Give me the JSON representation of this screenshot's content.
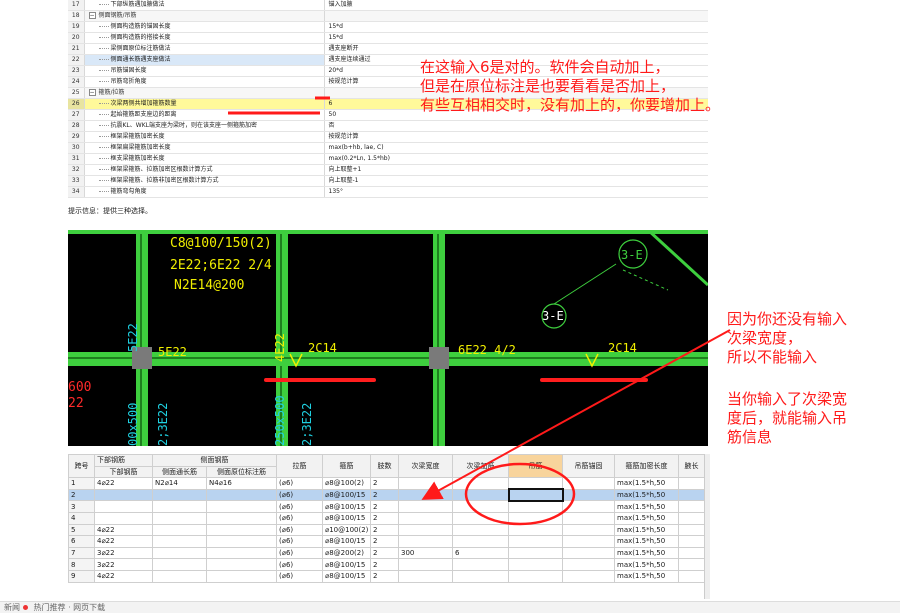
{
  "properties": {
    "rows": [
      {
        "num": "17",
        "name": "下部纵筋遇加腋做法",
        "value": "锚入加腋",
        "type": "item"
      },
      {
        "num": "18",
        "name": "侧面钢筋/吊筋",
        "value": "",
        "type": "group"
      },
      {
        "num": "19",
        "name": "侧面构造筋的锚固长度",
        "value": "15*d",
        "type": "item"
      },
      {
        "num": "20",
        "name": "侧面构造筋的搭接长度",
        "value": "15*d",
        "type": "item"
      },
      {
        "num": "21",
        "name": "梁侧面原位标注筋做法",
        "value": "遇支座断开",
        "type": "item"
      },
      {
        "num": "22",
        "name": "侧面通长筋遇支座做法",
        "value": "遇支座连续通过",
        "type": "item-hlname"
      },
      {
        "num": "23",
        "name": "吊筋锚固长度",
        "value": "20*d",
        "type": "item"
      },
      {
        "num": "24",
        "name": "吊筋弯折角度",
        "value": "按规范计算",
        "type": "item"
      },
      {
        "num": "25",
        "name": "箍筋/拉筋",
        "value": "",
        "type": "group"
      },
      {
        "num": "26",
        "name": "次梁两侧共增加箍筋数量",
        "value": "6",
        "type": "item-hl"
      },
      {
        "num": "27",
        "name": "起始箍筋距支座边的距离",
        "value": "50",
        "type": "item"
      },
      {
        "num": "28",
        "name": "抗震KL、WKL端支座为梁时，则在该支座一侧箍筋加密",
        "value": "否",
        "type": "item"
      },
      {
        "num": "29",
        "name": "框架梁箍筋加密长度",
        "value": "按规范计算",
        "type": "item"
      },
      {
        "num": "30",
        "name": "框架扁梁箍筋加密长度",
        "value": "max(b+hb, lae, C)",
        "type": "item"
      },
      {
        "num": "31",
        "name": "框支梁箍筋加密长度",
        "value": "max(0.2*Ln, 1.5*hb)",
        "type": "item"
      },
      {
        "num": "32",
        "name": "框架梁箍筋、拉筋加密区根数计算方式",
        "value": "向上取整+1",
        "type": "item"
      },
      {
        "num": "33",
        "name": "框架梁箍筋、拉筋非加密区根数计算方式",
        "value": "向上取整-1",
        "type": "item"
      },
      {
        "num": "34",
        "name": "箍筋弯勾角度",
        "value": "135°",
        "type": "item"
      }
    ],
    "hint": "提示信息：提供三种选择。"
  },
  "annotations": {
    "top": [
      "在这输入6是对的。软件会自动加上，",
      "但是在原位标注是也要看看是否加上，",
      "有些互相相交时，没有加上的，你要增加上。"
    ],
    "right1": [
      "因为你还没有输入",
      "次梁宽度，",
      "所以不能输入"
    ],
    "right2": [
      "当你输入了次梁宽",
      "度后，就能输入吊",
      "筋信息"
    ]
  },
  "cad": {
    "labels": {
      "stirrup": "C8@100/150(2)",
      "top_bars": "2E22;6E22 2/4",
      "side_bars": "N2E14@200",
      "left_5e22": "5E22",
      "bottom_5e22": "5E22",
      "v_4e22": "4E22",
      "c14_a": "2C14",
      "e22_42": "6E22 4/2",
      "c14_b": "2C14",
      "axis_3e_a": "3-E",
      "axis_3e_b": "3-E",
      "v_left": "5E22",
      "v_bot_left": "00x500",
      "v_bot_left2": "2;3E22",
      "v_bot_mid": "250x500",
      "v_bot_mid2": "2;3E22",
      "red_600": "600",
      "red_22": "22"
    }
  },
  "beam_table": {
    "group_headers": {
      "bottom": "下部钢筋",
      "side": "侧面钢筋"
    },
    "headers": [
      "跨号",
      "下部钢筋",
      "侧面通长筋",
      "侧面原位标注筋",
      "拉筋",
      "箍筋",
      "肢数",
      "次梁宽度",
      "次梁加筋",
      "吊筋",
      "吊筋锚固",
      "箍筋加密长度",
      "腋长"
    ],
    "rows": [
      [
        "1",
        "4⌀22",
        "N2⌀14",
        "N4⌀16",
        "(⌀6)",
        "⌀8@100(2)",
        "2",
        "",
        "",
        "",
        "",
        "max(1.5*h,50",
        ""
      ],
      [
        "2",
        "",
        "",
        "",
        "(⌀6)",
        "⌀8@100/15",
        "2",
        "",
        "",
        "",
        "",
        "max(1.5*h,50",
        ""
      ],
      [
        "3",
        "",
        "",
        "",
        "(⌀6)",
        "⌀8@100/15",
        "2",
        "",
        "",
        "",
        "",
        "max(1.5*h,50",
        ""
      ],
      [
        "4",
        "",
        "",
        "",
        "(⌀6)",
        "⌀8@100/15",
        "2",
        "",
        "",
        "",
        "",
        "max(1.5*h,50",
        ""
      ],
      [
        "5",
        "4⌀22",
        "",
        "",
        "(⌀6)",
        "⌀10@100(2)",
        "2",
        "",
        "",
        "",
        "",
        "max(1.5*h,50",
        ""
      ],
      [
        "6",
        "4⌀22",
        "",
        "",
        "(⌀6)",
        "⌀8@100/15",
        "2",
        "",
        "",
        "",
        "",
        "max(1.5*h,50",
        ""
      ],
      [
        "7",
        "3⌀22",
        "",
        "",
        "(⌀6)",
        "⌀8@200(2)",
        "2",
        "300",
        "6",
        "",
        "",
        "max(1.5*h,50",
        ""
      ],
      [
        "8",
        "3⌀22",
        "",
        "",
        "(⌀6)",
        "⌀8@100/15",
        "2",
        "",
        "",
        "",
        "",
        "max(1.5*h,50",
        ""
      ],
      [
        "9",
        "4⌀22",
        "",
        "",
        "(⌀6)",
        "⌀8@100/15",
        "2",
        "",
        "",
        "",
        "",
        "max(1.5*h,50",
        ""
      ]
    ]
  },
  "status": {
    "text1": "新闻",
    "text2": "热门推荐 · 网页下载"
  },
  "colors": {
    "annotation": "#ff1a1a",
    "cad_bg": "#000000",
    "cad_green": "#3ecf3e",
    "cad_yellow": "#f0ee00",
    "cad_cyan": "#1fd0e0",
    "row_select": "#b9d3f0",
    "row_highlight": "#fff99a"
  }
}
